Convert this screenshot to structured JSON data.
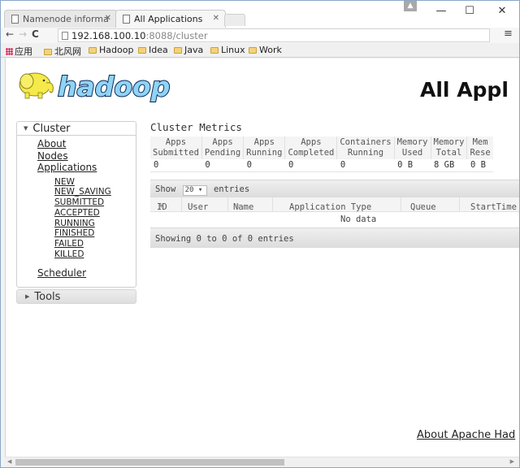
{
  "browser": {
    "tabs": [
      {
        "title": "Namenode informa",
        "active": false
      },
      {
        "title": "All Applications",
        "active": true
      }
    ],
    "address": {
      "host": "192.168.100.10",
      "path": ":8088/cluster"
    },
    "bookmarks": [
      "应用",
      "北风网",
      "Hadoop",
      "Idea",
      "Java",
      "Linux",
      "Work"
    ],
    "window_controls": {
      "minimize": "—",
      "maximize": "☐",
      "close": "✕"
    }
  },
  "header": {
    "logo_text": "hadoop",
    "title": "All Appl"
  },
  "sidebar": {
    "cluster_label": "Cluster",
    "links": [
      "About",
      "Nodes",
      "Applications"
    ],
    "app_states": [
      "NEW",
      "NEW_SAVING",
      "SUBMITTED",
      "ACCEPTED",
      "RUNNING",
      "FINISHED",
      "FAILED",
      "KILLED"
    ],
    "scheduler_label": "Scheduler",
    "tools_label": "Tools"
  },
  "metrics": {
    "title": "Cluster Metrics",
    "columns": [
      {
        "line1": "Apps",
        "line2": "Submitted",
        "value": "0"
      },
      {
        "line1": "Apps",
        "line2": "Pending",
        "value": "0"
      },
      {
        "line1": "Apps",
        "line2": "Running",
        "value": "0"
      },
      {
        "line1": "Apps",
        "line2": "Completed",
        "value": "0"
      },
      {
        "line1": "Containers",
        "line2": "Running",
        "value": "0"
      },
      {
        "line1": "Memory",
        "line2": "Used",
        "value": "0 B"
      },
      {
        "line1": "Memory",
        "line2": "Total",
        "value": "8 GB"
      },
      {
        "line1": "Mem",
        "line2": "Rese",
        "value": "0 B"
      }
    ]
  },
  "apps_table": {
    "show_label": "Show",
    "page_length": "20",
    "entries_label": "entries",
    "columns": [
      "ID",
      "User",
      "Name",
      "Application Type",
      "Queue",
      "StartTime"
    ],
    "empty_text": "No data",
    "info_text": "Showing 0 to 0 of 0 entries"
  },
  "footer": {
    "link": "About Apache Had"
  }
}
